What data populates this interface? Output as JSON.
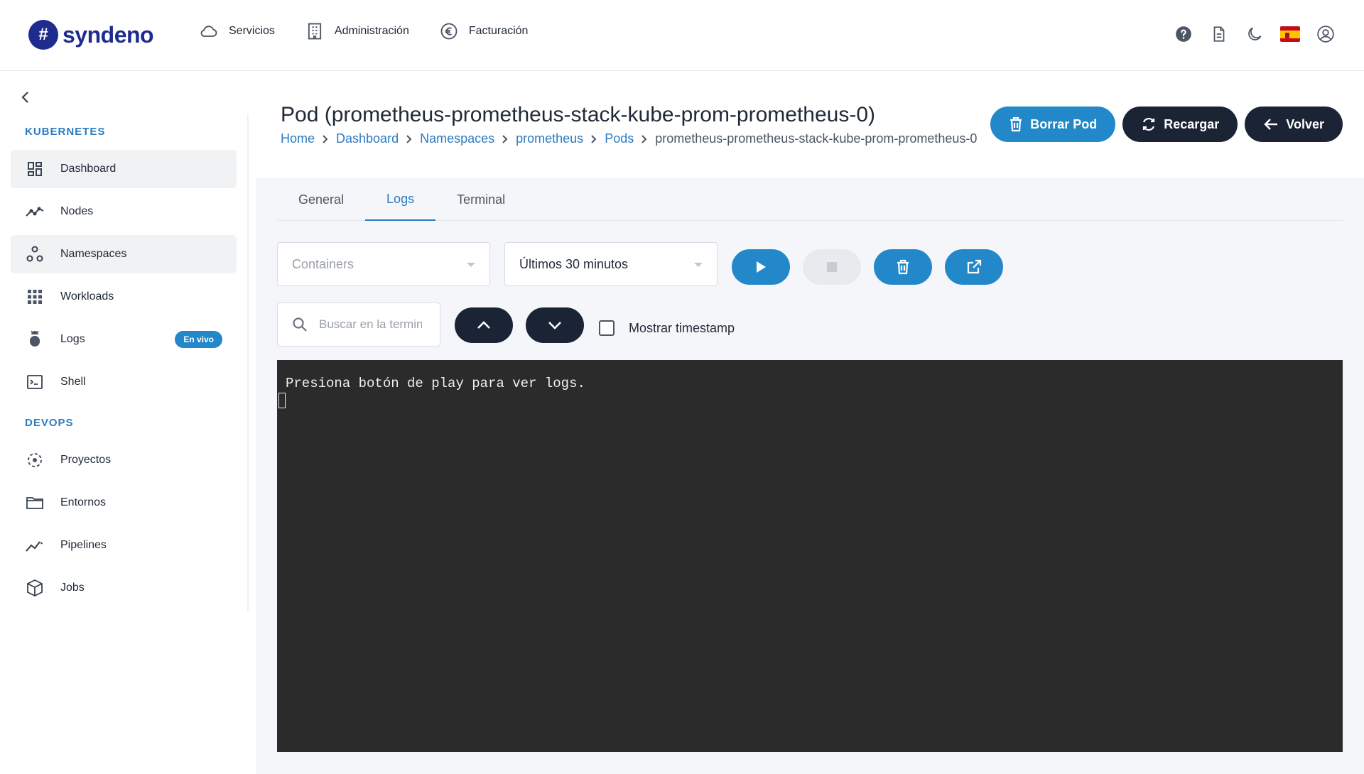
{
  "brand": {
    "logo_mark": "#",
    "name": "syndeno",
    "color": "#1e2b8f"
  },
  "topnav": [
    {
      "label": "Servicios",
      "icon": "cloud-icon"
    },
    {
      "label": "Administración",
      "icon": "building-icon"
    },
    {
      "label": "Facturación",
      "icon": "euro-icon"
    }
  ],
  "top_right_icons": [
    "help-icon",
    "document-icon",
    "moon-icon",
    "spain-flag-icon",
    "user-icon"
  ],
  "sidebar": {
    "sections": [
      {
        "title": "KUBERNETES"
      },
      {
        "title": "DEVOPS"
      }
    ],
    "items": [
      {
        "label": "Dashboard",
        "icon": "dashboard-icon",
        "active": true
      },
      {
        "label": "Nodes",
        "icon": "nodes-icon"
      },
      {
        "label": "Namespaces",
        "icon": "namespaces-icon",
        "active": true
      },
      {
        "label": "Workloads",
        "icon": "grid-icon"
      },
      {
        "label": "Logs",
        "icon": "bug-icon",
        "badge": "En vivo"
      },
      {
        "label": "Shell",
        "icon": "terminal-icon"
      },
      {
        "label": "Proyectos",
        "icon": "projects-icon"
      },
      {
        "label": "Entornos",
        "icon": "folder-icon"
      },
      {
        "label": "Pipelines",
        "icon": "pipeline-icon"
      },
      {
        "label": "Jobs",
        "icon": "cube-icon"
      }
    ]
  },
  "page": {
    "title": "Pod (prometheus-prometheus-stack-kube-prom-prometheus-0)",
    "breadcrumb": [
      "Home",
      "Dashboard",
      "Namespaces",
      "prometheus",
      "Pods",
      "prometheus-prometheus-stack-kube-prom-prometheus-0"
    ],
    "actions": {
      "delete": "Borrar Pod",
      "reload": "Recargar",
      "back": "Volver"
    }
  },
  "tabs": [
    {
      "label": "General"
    },
    {
      "label": "Logs",
      "active": true
    },
    {
      "label": "Terminal"
    }
  ],
  "controls": {
    "containers_placeholder": "Containers",
    "time_range": "Últimos 30 minutos",
    "search_placeholder": "Buscar en la terminal",
    "timestamp_label": "Mostrar timestamp"
  },
  "terminal": {
    "message": "Presiona botón de play para ver logs."
  },
  "colors": {
    "accent": "#2388c9",
    "dark": "#1a2435",
    "link": "#2b7bc0",
    "terminal_bg": "#2b2b2b"
  }
}
